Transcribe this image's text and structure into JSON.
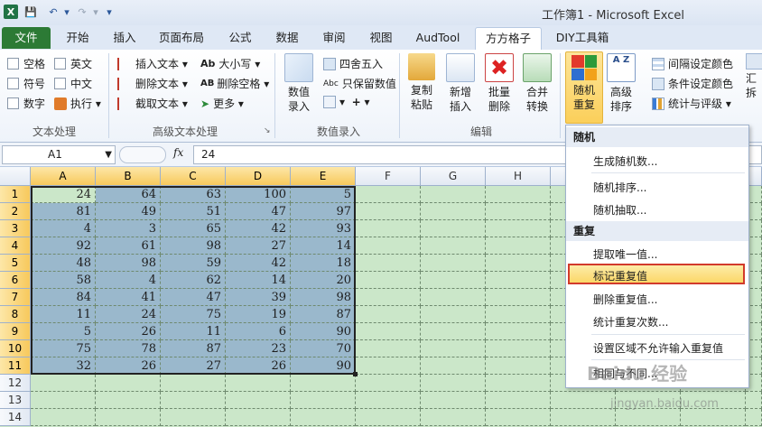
{
  "window": {
    "title": "工作簿1 - Microsoft Excel"
  },
  "tabs": [
    "文件",
    "开始",
    "插入",
    "页面布局",
    "公式",
    "数据",
    "审阅",
    "视图",
    "AudTool",
    "方方格子",
    "DIY工具箱"
  ],
  "ribbon": {
    "text_group": {
      "label": "文本处理",
      "checks": [
        "空格",
        "英文",
        "符号",
        "中文",
        "数字"
      ],
      "exec": "执行"
    },
    "adv_text_group": {
      "label": "高级文本处理",
      "items": [
        "插入文本",
        "删除文本",
        "截取文本",
        "大小写",
        "删除空格",
        "更多"
      ]
    },
    "input_group": {
      "label": "数值录入",
      "big": "数值\n录入",
      "items": [
        "四舍五入",
        "只保留数值"
      ]
    },
    "edit_group": {
      "label": "编辑",
      "buttons": [
        "复制\n粘贴",
        "新增\n插入",
        "批量\n删除",
        "合并\n转换"
      ]
    },
    "random_group": {
      "buttons": [
        "随机\n重复",
        "高级\n排序"
      ],
      "items": [
        "间隔设定颜色",
        "条件设定颜色",
        "统计与评级"
      ],
      "cut": "汇\n拆"
    }
  },
  "formula_bar": {
    "name": "A1",
    "fx": "fx",
    "value": "24"
  },
  "columns": [
    "A",
    "B",
    "C",
    "D",
    "E",
    "F",
    "G",
    "H"
  ],
  "rows": [
    "1",
    "2",
    "3",
    "4",
    "5",
    "6",
    "7",
    "8",
    "9",
    "10",
    "11",
    "12",
    "13",
    "14"
  ],
  "cells": [
    [
      24,
      64,
      63,
      100,
      5
    ],
    [
      81,
      49,
      51,
      47,
      97
    ],
    [
      4,
      3,
      65,
      42,
      93
    ],
    [
      92,
      61,
      98,
      27,
      14
    ],
    [
      48,
      98,
      59,
      42,
      18
    ],
    [
      58,
      4,
      62,
      14,
      20
    ],
    [
      84,
      41,
      47,
      39,
      98
    ],
    [
      11,
      24,
      75,
      19,
      87
    ],
    [
      5,
      26,
      11,
      6,
      90
    ],
    [
      75,
      78,
      87,
      23,
      70
    ],
    [
      32,
      26,
      27,
      26,
      90
    ]
  ],
  "menu": {
    "sections": [
      {
        "header": "随机",
        "items": [
          "生成随机数...",
          "随机排序...",
          "随机抽取..."
        ]
      },
      {
        "header": "重复",
        "items": [
          "提取唯一值...",
          "标记重复值",
          "删除重复值...",
          "统计重复次数...",
          "设置区域不允许输入重复值",
          "相同与不同..."
        ]
      }
    ]
  },
  "watermark": {
    "text": "Baidu 经验",
    "url": "jingyan.baidu.com"
  }
}
